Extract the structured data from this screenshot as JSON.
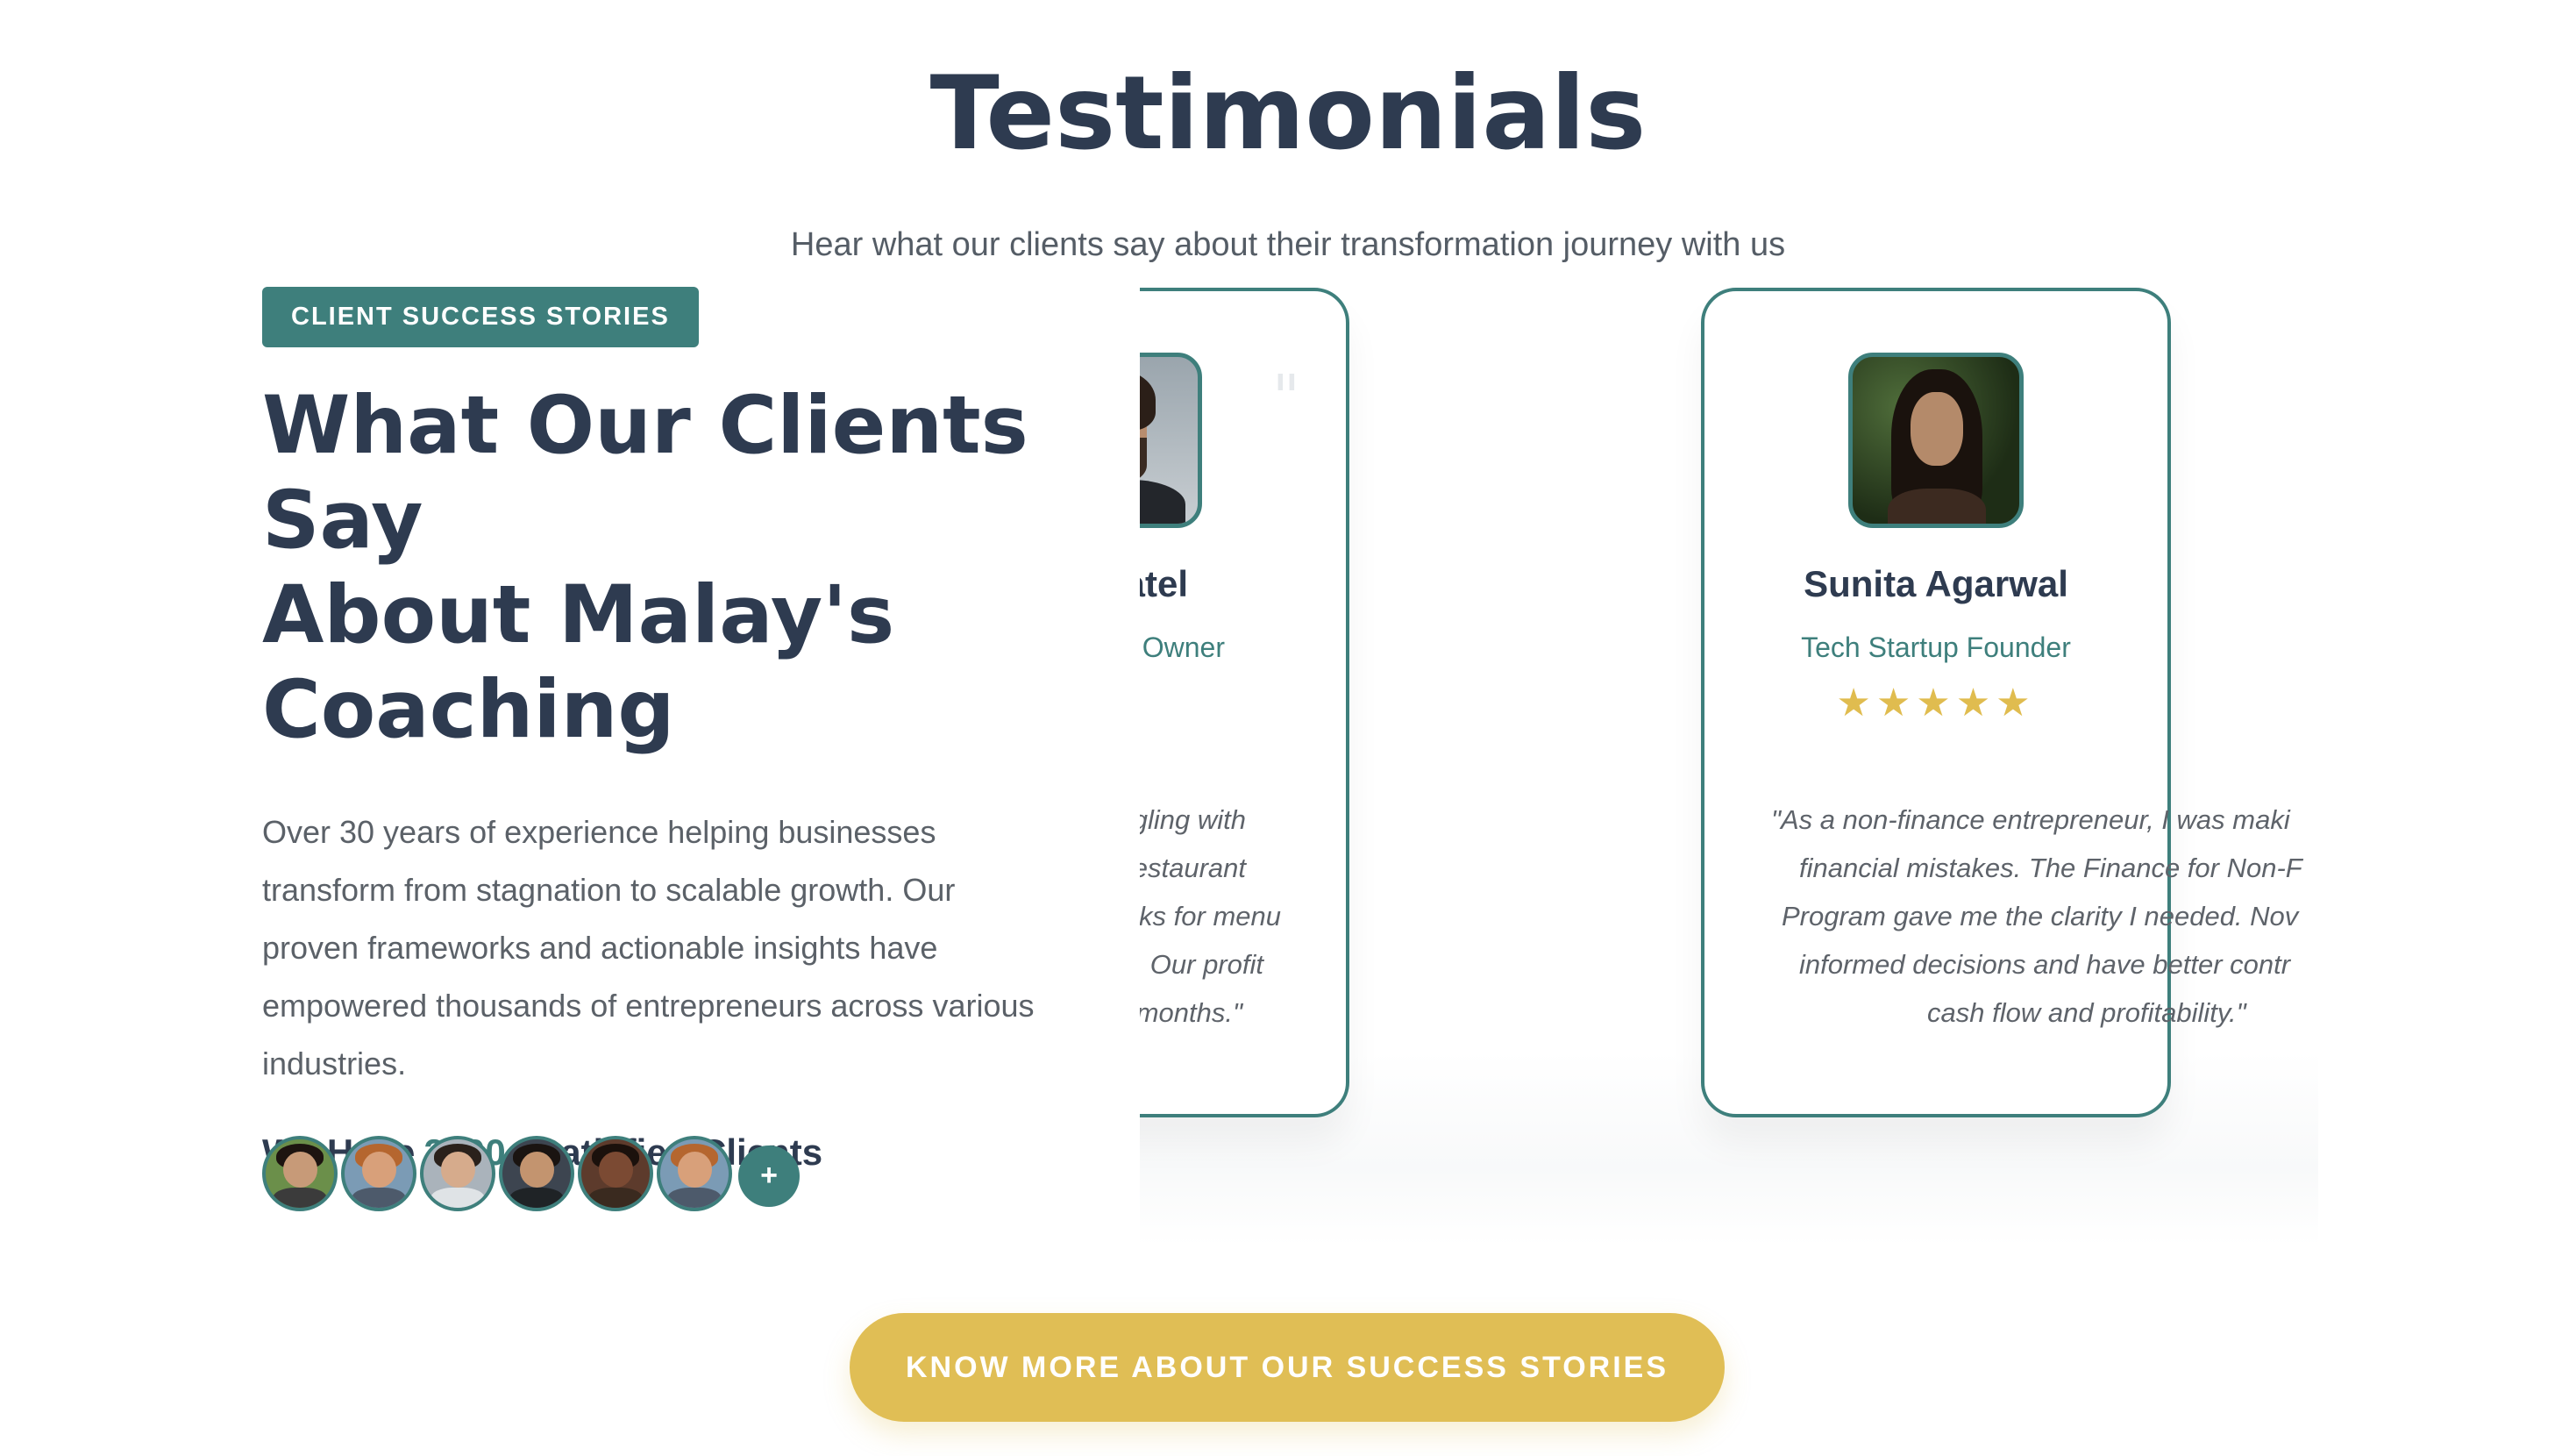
{
  "section": {
    "title": "Testimonials",
    "subtitle": "Hear what our clients say about their transformation journey with us"
  },
  "intro": {
    "badge": "CLIENT SUCCESS STORIES",
    "heading_lines": [
      "What Our Clients Say",
      "About Malay's",
      "Coaching"
    ],
    "description_lines": [
      "Over 30 years of experience helping businesses",
      "transform from stagnation to scalable growth. Our",
      "proven frameworks and actionable insights have",
      "empowered thousands of entrepreneurs across various",
      "industries."
    ],
    "clients_prefix": "We Have",
    "clients_count": "2500+",
    "clients_suffix": "Satisfied Clients",
    "more_avatars_label": "+"
  },
  "testimonials": [
    {
      "name_visible": "it Patel",
      "role_visible": "t Chain Owner",
      "stars": "★ ★ ★",
      "quote_mark": "\"",
      "quote_lines_visible": [
        "ness was struggling with",
        "ability. Malay's Restaurant",
        "d clear frameworks for menu",
        "ational efficiency. Our profit",
        "y 25% within 4 months.\""
      ]
    },
    {
      "name": "Sunita Agarwal",
      "role": "Tech Startup Founder",
      "stars": "★★★★★",
      "quote_lines_visible": [
        "\"As a non-finance entrepreneur, I was maki",
        "financial mistakes. The Finance for Non-F",
        "Program gave me the clarity I needed. Nov",
        "informed decisions and have better contr",
        "cash flow and profitability.\""
      ]
    }
  ],
  "cta": {
    "label": "KNOW MORE ABOUT OUR SUCCESS STORIES"
  },
  "colors": {
    "teal": "#3e7f7c",
    "navy": "#2e3b50",
    "gold": "#e0be55"
  }
}
